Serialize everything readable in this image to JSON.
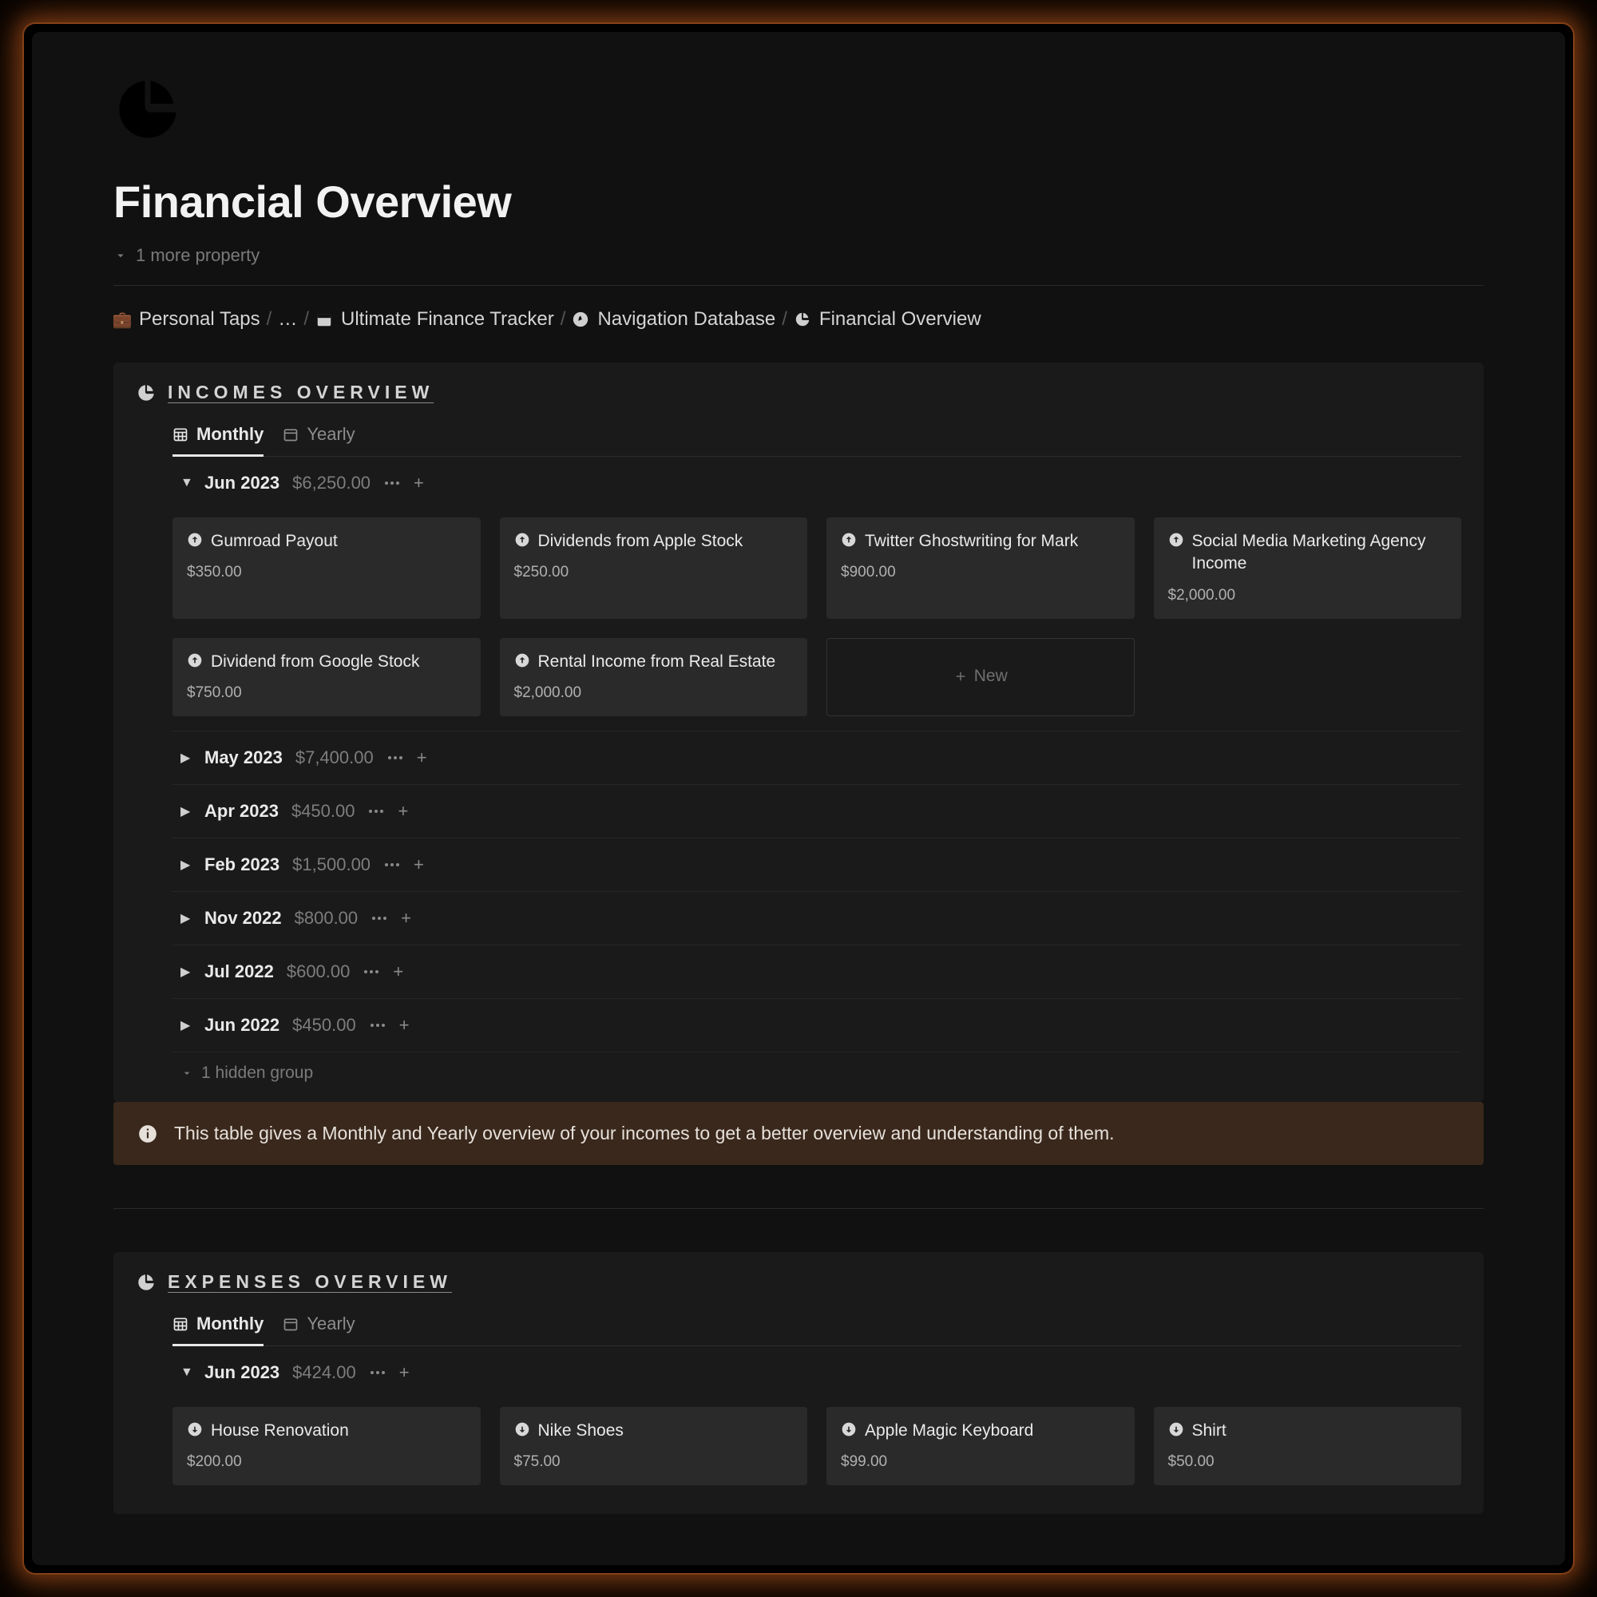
{
  "page": {
    "title": "Financial Overview",
    "more_property": "1 more property"
  },
  "breadcrumb": {
    "items": [
      {
        "label": "Personal Taps"
      },
      {
        "label": "…"
      },
      {
        "label": "Ultimate Finance Tracker"
      },
      {
        "label": "Navigation Database"
      },
      {
        "label": "Financial Overview"
      }
    ]
  },
  "incomes": {
    "title": "INCOMES OVERVIEW",
    "tabs": {
      "monthly": "Monthly",
      "yearly": "Yearly"
    },
    "open_group": {
      "name": "Jun 2023",
      "total": "$6,250.00",
      "cards": [
        {
          "title": "Gumroad Payout",
          "amount": "$350.00"
        },
        {
          "title": "Dividends from Apple Stock",
          "amount": "$250.00"
        },
        {
          "title": "Twitter Ghostwriting for Mark",
          "amount": "$900.00"
        },
        {
          "title": "Social Media Marketing Agency Income",
          "amount": "$2,000.00"
        },
        {
          "title": "Dividend from Google Stock",
          "amount": "$750.00"
        },
        {
          "title": "Rental Income from Real Estate",
          "amount": "$2,000.00"
        }
      ],
      "new_label": "New"
    },
    "collapsed_groups": [
      {
        "name": "May 2023",
        "total": "$7,400.00"
      },
      {
        "name": "Apr 2023",
        "total": "$450.00"
      },
      {
        "name": "Feb 2023",
        "total": "$1,500.00"
      },
      {
        "name": "Nov 2022",
        "total": "$800.00"
      },
      {
        "name": "Jul 2022",
        "total": "$600.00"
      },
      {
        "name": "Jun 2022",
        "total": "$450.00"
      }
    ],
    "hidden_groups": "1 hidden group",
    "info": "This table gives a Monthly and Yearly overview of your incomes to get a better overview and understanding of them."
  },
  "expenses": {
    "title": "EXPENSES OVERVIEW",
    "tabs": {
      "monthly": "Monthly",
      "yearly": "Yearly"
    },
    "open_group": {
      "name": "Jun 2023",
      "total": "$424.00",
      "cards": [
        {
          "title": "House Renovation",
          "amount": "$200.00"
        },
        {
          "title": "Nike Shoes",
          "amount": "$75.00"
        },
        {
          "title": "Apple Magic Keyboard",
          "amount": "$99.00"
        },
        {
          "title": "Shirt",
          "amount": "$50.00"
        }
      ]
    }
  }
}
